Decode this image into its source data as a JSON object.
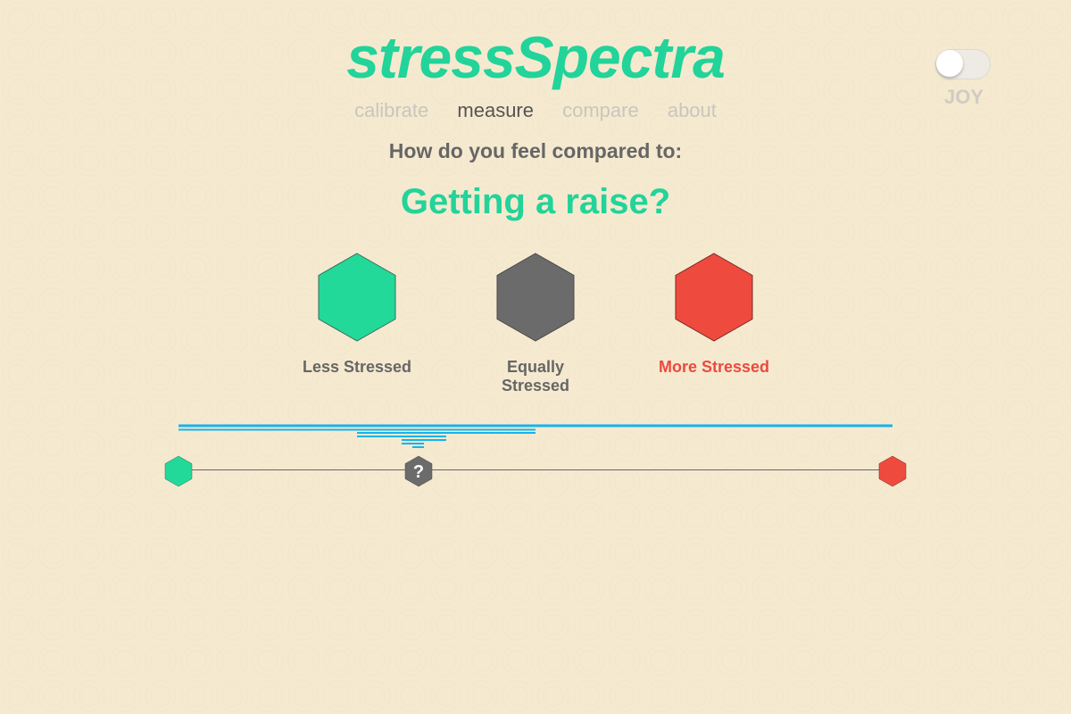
{
  "app": {
    "title": "stressSpectra"
  },
  "nav": {
    "items": [
      {
        "label": "calibrate",
        "active": false
      },
      {
        "label": "measure",
        "active": true
      },
      {
        "label": "compare",
        "active": false
      },
      {
        "label": "about",
        "active": false
      }
    ]
  },
  "toggle": {
    "label": "JOY",
    "state": "off"
  },
  "prompt": {
    "text": "How do you feel compared to:"
  },
  "question": {
    "text": "Getting a raise?"
  },
  "options": {
    "less": {
      "label": "Less Stressed",
      "color": "#22d99a",
      "icon": "hexagon-icon"
    },
    "equal": {
      "label": "Equally Stressed",
      "color": "#6b6b6b",
      "icon": "hexagon-icon"
    },
    "more": {
      "label": "More Stressed",
      "color": "#ef4a3e",
      "icon": "hexagon-icon"
    }
  },
  "slider": {
    "marker_text": "?",
    "marker_position": 0.33,
    "left_color": "#22d99a",
    "right_color": "#ef4a3e",
    "marker_color": "#6b6b6b",
    "bar_color": "#16b3ec"
  }
}
